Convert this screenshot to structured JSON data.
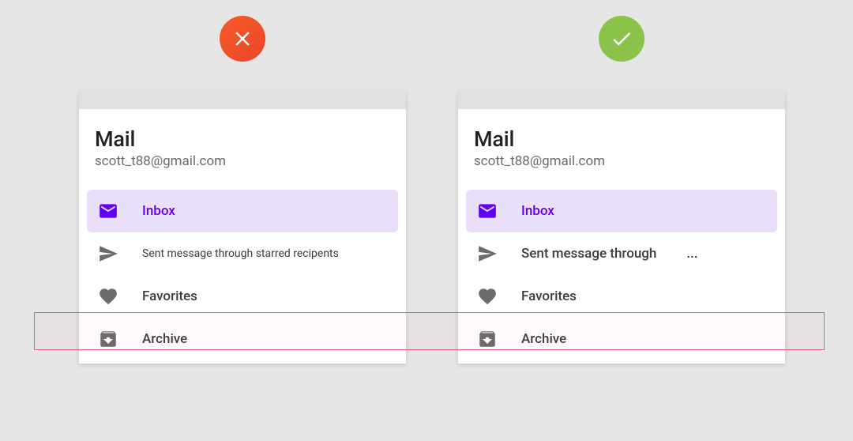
{
  "left": {
    "badge": "dont",
    "title": "Mail",
    "email": "scott_t88@gmail.com",
    "items": [
      {
        "label": "Inbox",
        "icon": "mail",
        "active": true
      },
      {
        "label": "Sent message through starred recipents",
        "icon": "send",
        "wrong": true
      },
      {
        "label": "Favorites",
        "icon": "heart"
      },
      {
        "label": "Archive",
        "icon": "archive"
      }
    ]
  },
  "right": {
    "badge": "do",
    "title": "Mail",
    "email": "scott_t88@gmail.com",
    "items": [
      {
        "label": "Inbox",
        "icon": "mail",
        "active": true
      },
      {
        "label": "Sent message through",
        "icon": "send",
        "ellipsis": "..."
      },
      {
        "label": "Favorites",
        "icon": "heart"
      },
      {
        "label": "Archive",
        "icon": "archive"
      }
    ]
  }
}
